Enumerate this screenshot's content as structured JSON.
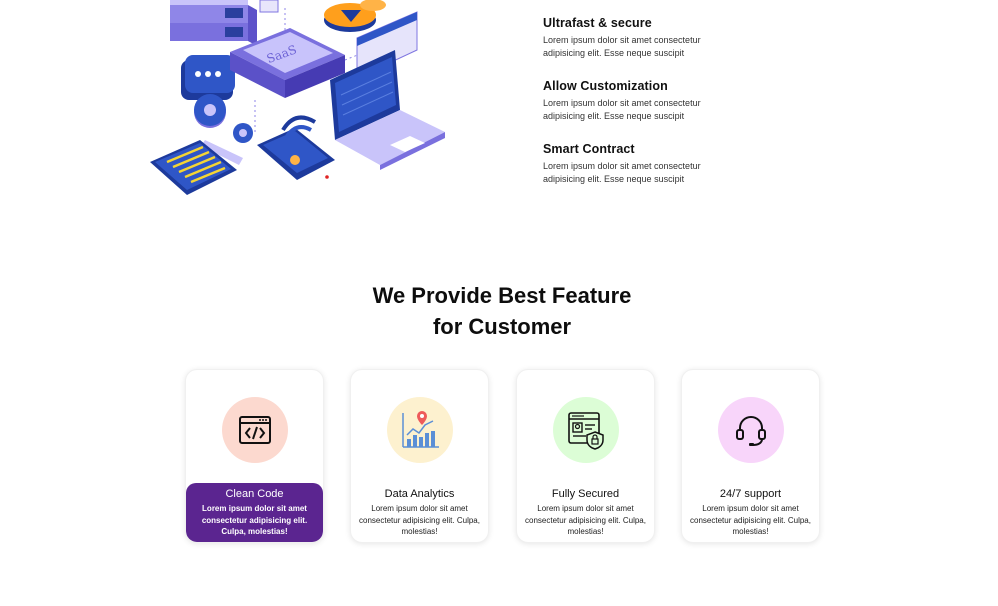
{
  "features_top": [
    {
      "title": "Ultrafast & secure",
      "text": "Lorem ipsum dolor sit amet consectetur adipisicing elit. Esse neque suscipit"
    },
    {
      "title": "Allow Customization",
      "text": "Lorem ipsum dolor sit amet consectetur adipisicing elit. Esse neque suscipit"
    },
    {
      "title": "Smart Contract",
      "text": "Lorem ipsum dolor sit amet consectetur adipisicing elit. Esse neque suscipit"
    }
  ],
  "illustration": {
    "saas_label": "SaaS"
  },
  "section": {
    "title_line1": "We Provide Best Feature",
    "title_line2": "for Customer"
  },
  "cards": [
    {
      "title": "Clean Code",
      "text": "Lorem ipsum dolor sit amet consectetur adipisicing elit. Culpa, molestias!",
      "icon": "code-window-icon",
      "bg": "#fcd9cf",
      "active": true
    },
    {
      "title": "Data Analytics",
      "text": "Lorem ipsum dolor sit amet consectetur adipisicing elit. Culpa, molestias!",
      "icon": "analytics-chart-icon",
      "bg": "#fdf1cf",
      "active": false
    },
    {
      "title": "Fully Secured",
      "text": "Lorem ipsum dolor sit amet consectetur adipisicing elit. Culpa, molestias!",
      "icon": "secure-profile-icon",
      "bg": "#dcfdd6",
      "active": false
    },
    {
      "title": "24/7 support",
      "text": "Lorem ipsum dolor sit amet consectetur adipisicing elit. Culpa, molestias!",
      "icon": "headset-icon",
      "bg": "#f8d5fa",
      "active": false
    }
  ],
  "colors": {
    "accent": "#5b2590",
    "illustration_blue": "#1d3a9c",
    "illustration_purple": "#8f86e8"
  }
}
